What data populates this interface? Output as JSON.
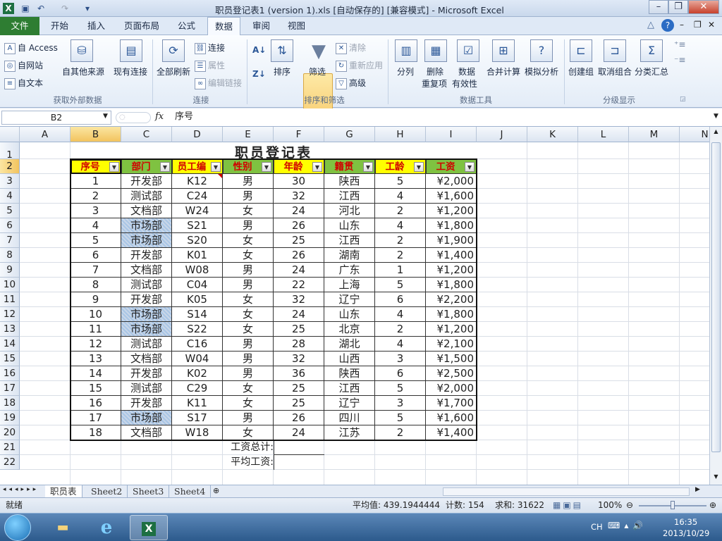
{
  "window": {
    "title": "职员登记表1 (version 1).xls [自动保存的]  [兼容模式]  -  Microsoft Excel"
  },
  "qat": {
    "app_icon": "excel-icon",
    "save_icon": "save-icon",
    "undo_icon": "undo-icon",
    "redo_icon": "redo-icon"
  },
  "tabs": [
    "文件",
    "开始",
    "插入",
    "页面布局",
    "公式",
    "数据",
    "审阅",
    "视图"
  ],
  "ribbon": {
    "ext": {
      "from_access": "自 Access",
      "from_web": "自网站",
      "from_text": "自文本",
      "other_sources": "自其他来源",
      "existing": "现有连接",
      "group": "获取外部数据"
    },
    "conn": {
      "refresh_all": "全部刷新",
      "connections": "连接",
      "properties": "属性",
      "edit_links": "编辑链接",
      "group": "连接"
    },
    "sort": {
      "sort": "排序",
      "filter": "筛选",
      "clear": "清除",
      "reapply": "重新应用",
      "advanced": "高级",
      "group": "排序和筛选"
    },
    "tools": {
      "split": "分列",
      "dedupe1": "删除",
      "dedupe2": "重复项",
      "validate1": "数据",
      "validate2": "有效性",
      "consolidate": "合并计算",
      "whatif": "模拟分析",
      "group": "数据工具"
    },
    "outline": {
      "group_btn": "创建组",
      "ungroup": "取消组合",
      "subtotal": "分类汇总",
      "group": "分级显示"
    }
  },
  "formula_bar": {
    "name_box": "B2",
    "fx": "fx",
    "content": "序号"
  },
  "sheet": {
    "columns": [
      "A",
      "B",
      "C",
      "D",
      "E",
      "F",
      "G",
      "H",
      "I",
      "J",
      "K",
      "L",
      "M",
      "N"
    ],
    "rows": [
      "1",
      "2",
      "3",
      "4",
      "5",
      "6",
      "7",
      "8",
      "9",
      "10",
      "11",
      "12",
      "13",
      "14",
      "15",
      "16",
      "17",
      "18",
      "19",
      "20",
      "21",
      "22"
    ],
    "title": "职员登记表",
    "headers": [
      "序号",
      "部门",
      "员工编",
      "性别",
      "年龄",
      "籍贯",
      "工龄",
      "工资"
    ],
    "records": [
      [
        "1",
        "开发部",
        "K12",
        "男",
        "30",
        "陕西",
        "5",
        "¥2,000"
      ],
      [
        "2",
        "测试部",
        "C24",
        "男",
        "32",
        "江西",
        "4",
        "¥1,600"
      ],
      [
        "3",
        "文档部",
        "W24",
        "女",
        "24",
        "河北",
        "2",
        "¥1,200"
      ],
      [
        "4",
        "市场部",
        "S21",
        "男",
        "26",
        "山东",
        "4",
        "¥1,800"
      ],
      [
        "5",
        "市场部",
        "S20",
        "女",
        "25",
        "江西",
        "2",
        "¥1,900"
      ],
      [
        "6",
        "开发部",
        "K01",
        "女",
        "26",
        "湖南",
        "2",
        "¥1,400"
      ],
      [
        "7",
        "文档部",
        "W08",
        "男",
        "24",
        "广东",
        "1",
        "¥1,200"
      ],
      [
        "8",
        "测试部",
        "C04",
        "男",
        "22",
        "上海",
        "5",
        "¥1,800"
      ],
      [
        "9",
        "开发部",
        "K05",
        "女",
        "32",
        "辽宁",
        "6",
        "¥2,200"
      ],
      [
        "10",
        "市场部",
        "S14",
        "女",
        "24",
        "山东",
        "4",
        "¥1,800"
      ],
      [
        "11",
        "市场部",
        "S22",
        "女",
        "25",
        "北京",
        "2",
        "¥1,200"
      ],
      [
        "12",
        "测试部",
        "C16",
        "男",
        "28",
        "湖北",
        "4",
        "¥2,100"
      ],
      [
        "13",
        "文档部",
        "W04",
        "男",
        "32",
        "山西",
        "3",
        "¥1,500"
      ],
      [
        "14",
        "开发部",
        "K02",
        "男",
        "36",
        "陕西",
        "6",
        "¥2,500"
      ],
      [
        "15",
        "测试部",
        "C29",
        "女",
        "25",
        "江西",
        "5",
        "¥2,000"
      ],
      [
        "16",
        "开发部",
        "K11",
        "女",
        "25",
        "辽宁",
        "3",
        "¥1,700"
      ],
      [
        "17",
        "市场部",
        "S17",
        "男",
        "26",
        "四川",
        "5",
        "¥1,600"
      ],
      [
        "18",
        "文档部",
        "W18",
        "女",
        "24",
        "江苏",
        "2",
        "¥1,400"
      ]
    ],
    "total_label": "工资总计:",
    "avg_label": "平均工资:"
  },
  "sheet_tabs": [
    "职员表",
    "Sheet2",
    "Sheet3",
    "Sheet4"
  ],
  "status": {
    "ready": "就绪",
    "average": "平均值: 439.1944444",
    "count": "计数: 154",
    "sum": "求和: 31622",
    "zoom": "100%"
  },
  "taskbar": {
    "lang": "CH",
    "time": "16:35",
    "date": "2013/10/29"
  },
  "colors": {
    "header_yellow": "#ffff00",
    "header_green": "#7fc241",
    "header_text": "#d10000",
    "table_fill": "#c5d9f1",
    "accent": "#f7c96a"
  }
}
